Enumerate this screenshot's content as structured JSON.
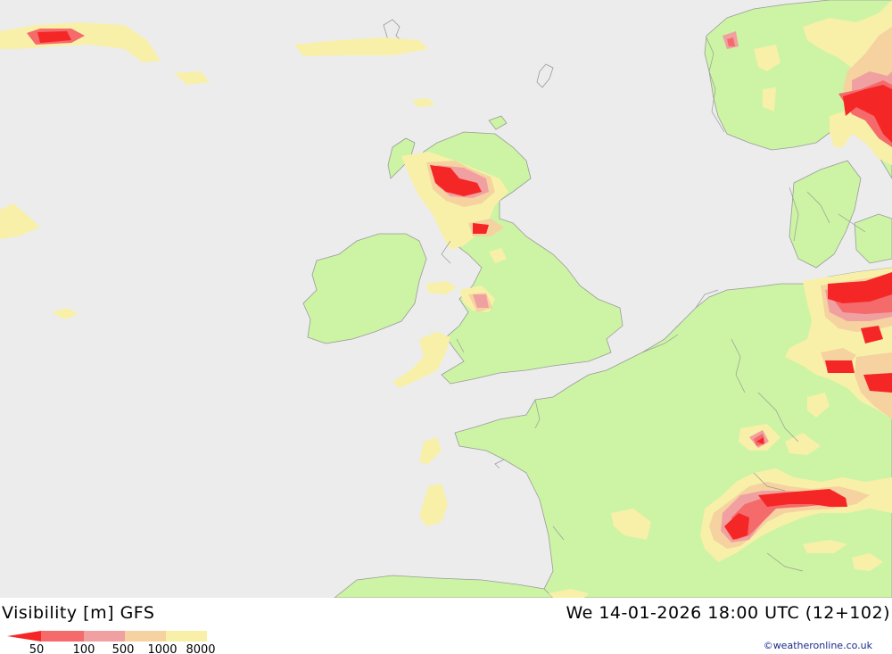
{
  "title": {
    "parameter": "Visibility [m]",
    "model": "GFS",
    "valid_time": "We 14-01-2026 18:00 UTC (12+102)"
  },
  "legend": {
    "ticks": [
      "50",
      "100",
      "500",
      "1000",
      "8000"
    ],
    "colors": [
      "#f52626",
      "#f56a6a",
      "#f0a0a0",
      "#f5d2a0",
      "#f8f0a8"
    ]
  },
  "credit": "©weatheronline.co.uk",
  "colors": {
    "sea": "#ececec",
    "land": "#ccf4a4",
    "coast": "#9a9a9a"
  }
}
